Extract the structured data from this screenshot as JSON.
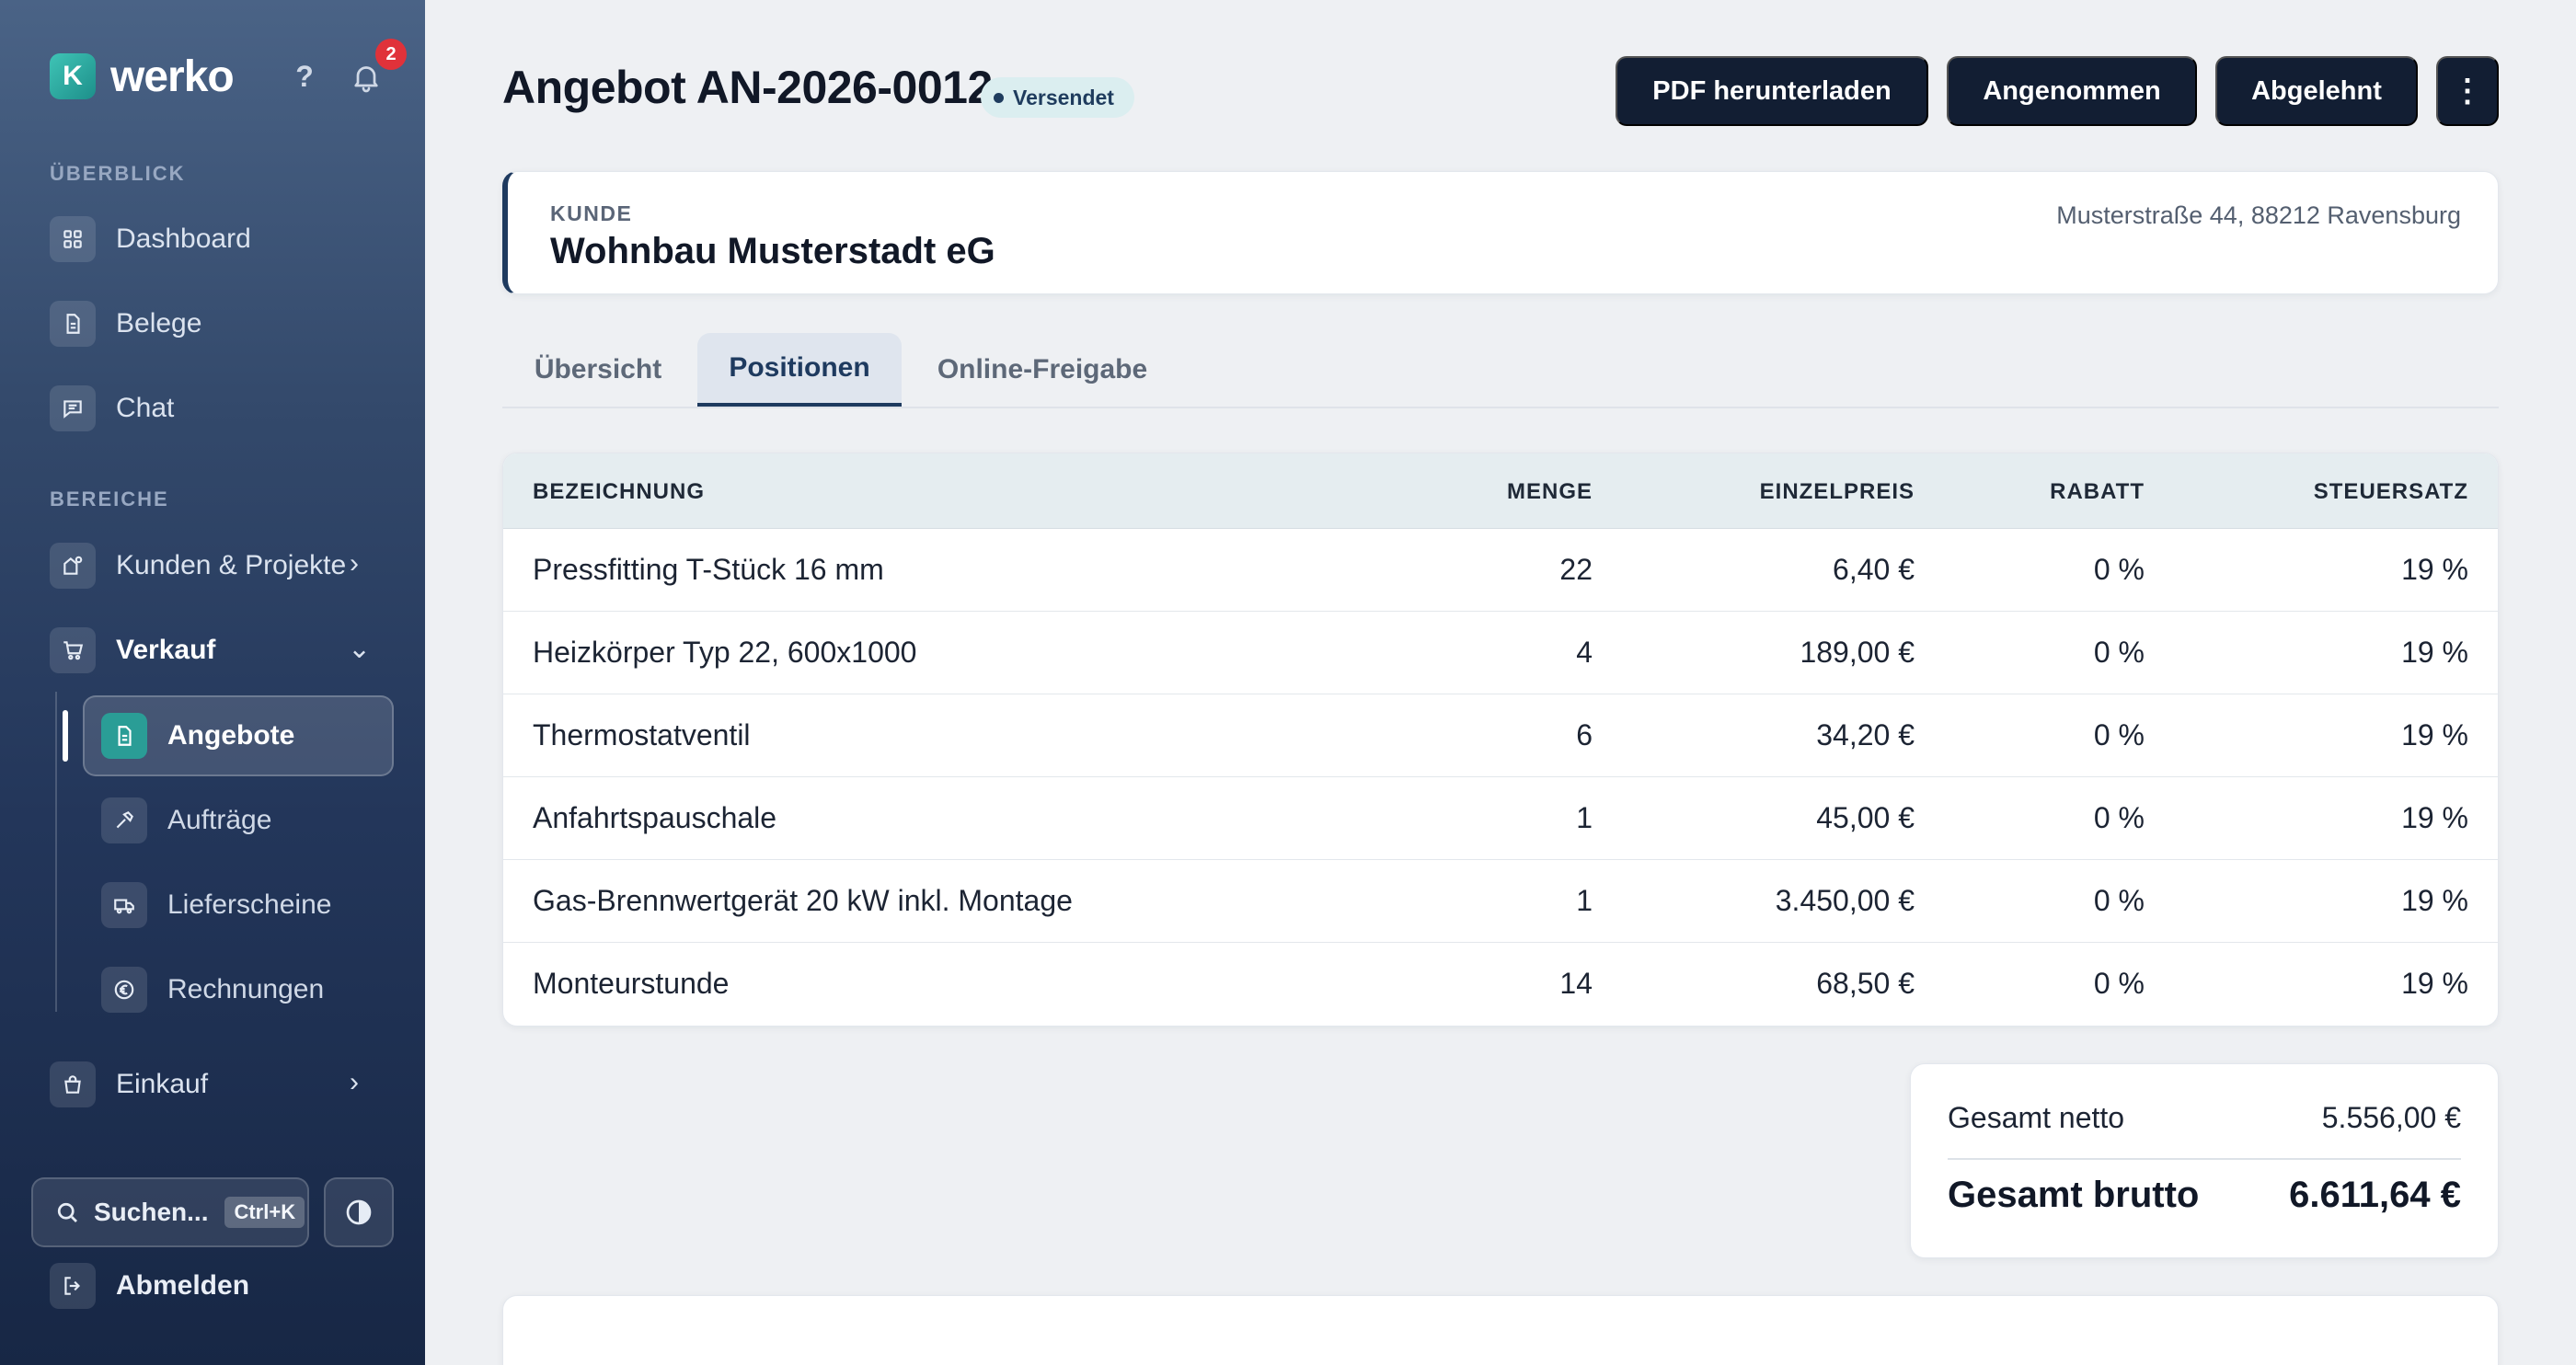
{
  "app": {
    "logo_letter": "K",
    "name": "werko",
    "help_label": "?",
    "notification_count": "2",
    "accent_color": "#2a9d96"
  },
  "sidebar": {
    "section_overview": "ÜBERBLICK",
    "section_areas": "BEREICHE",
    "overview_items": [
      {
        "label": "Dashboard",
        "icon": "dashboard-icon"
      },
      {
        "label": "Belege",
        "icon": "document-icon"
      },
      {
        "label": "Chat",
        "icon": "chat-icon"
      }
    ],
    "area_items": [
      {
        "label": "Kunden & Projekte",
        "icon": "customers-icon"
      },
      {
        "label": "Verkauf",
        "icon": "cart-icon"
      },
      {
        "label": "Einkauf",
        "icon": "shopping-bag-icon"
      }
    ],
    "sales_sub_items": [
      {
        "label": "Angebote",
        "icon": "offer-document-icon",
        "active": true
      },
      {
        "label": "Aufträge",
        "icon": "hammer-icon"
      },
      {
        "label": "Lieferscheine",
        "icon": "truck-icon"
      },
      {
        "label": "Rechnungen",
        "icon": "euro-icon"
      }
    ],
    "search_label": "Suchen...",
    "search_shortcut": "Ctrl+K",
    "logout_label": "Abmelden"
  },
  "header": {
    "title": "Angebot AN-2026-0012",
    "status": "Versendet",
    "actions": {
      "pdf": "PDF herunterladen",
      "accepted": "Angenommen",
      "rejected": "Abgelehnt",
      "more": "⋮"
    }
  },
  "customer": {
    "label": "KUNDE",
    "name": "Wohnbau Musterstadt eG",
    "address": "Musterstraße 44, 88212 Ravensburg"
  },
  "tabs": [
    {
      "label": "Übersicht"
    },
    {
      "label": "Positionen",
      "active": true
    },
    {
      "label": "Online-Freigabe"
    }
  ],
  "table": {
    "columns": [
      "BEZEICHNUNG",
      "MENGE",
      "EINZELPREIS",
      "RABATT",
      "STEUERSATZ"
    ],
    "rows": [
      [
        "Pressfitting T-Stück 16 mm",
        "22",
        "6,40 €",
        "0 %",
        "19 %"
      ],
      [
        "Heizkörper Typ 22, 600x1000",
        "4",
        "189,00 €",
        "0 %",
        "19 %"
      ],
      [
        "Thermostatventil",
        "6",
        "34,20 €",
        "0 %",
        "19 %"
      ],
      [
        "Anfahrtspauschale",
        "1",
        "45,00 €",
        "0 %",
        "19 %"
      ],
      [
        "Gas-Brennwertgerät 20 kW inkl. Montage",
        "1",
        "3.450,00 €",
        "0 %",
        "19 %"
      ],
      [
        "Monteurstunde",
        "14",
        "68,50 €",
        "0 %",
        "19 %"
      ]
    ]
  },
  "totals": {
    "net_label": "Gesamt netto",
    "net_value": "5.556,00 €",
    "gross_label": "Gesamt brutto",
    "gross_value": "6.611,64 €"
  }
}
